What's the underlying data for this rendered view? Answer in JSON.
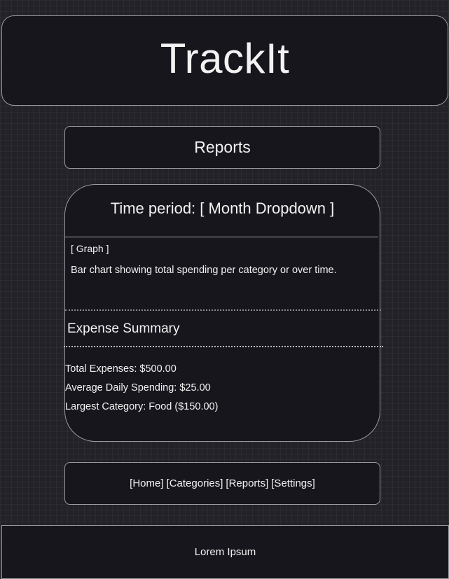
{
  "header": {
    "title": "TrackIt"
  },
  "page": {
    "title": "Reports"
  },
  "card": {
    "time_period": "Time period: [ Month Dropdown ]",
    "graph_tag": "[ Graph ]",
    "graph_description": "Bar chart showing total spending per category or over time.",
    "summary_title": "Expense Summary",
    "summary": {
      "total": "Total Expenses: $500.00",
      "average": "Average Daily Spending: $25.00",
      "largest": "Largest Category: Food ($150.00)"
    }
  },
  "nav": {
    "home": "[Home]",
    "categories": "[Categories]",
    "reports": "[Reports]",
    "settings": "[Settings]"
  },
  "footer": {
    "text": "Lorem Ipsum"
  }
}
